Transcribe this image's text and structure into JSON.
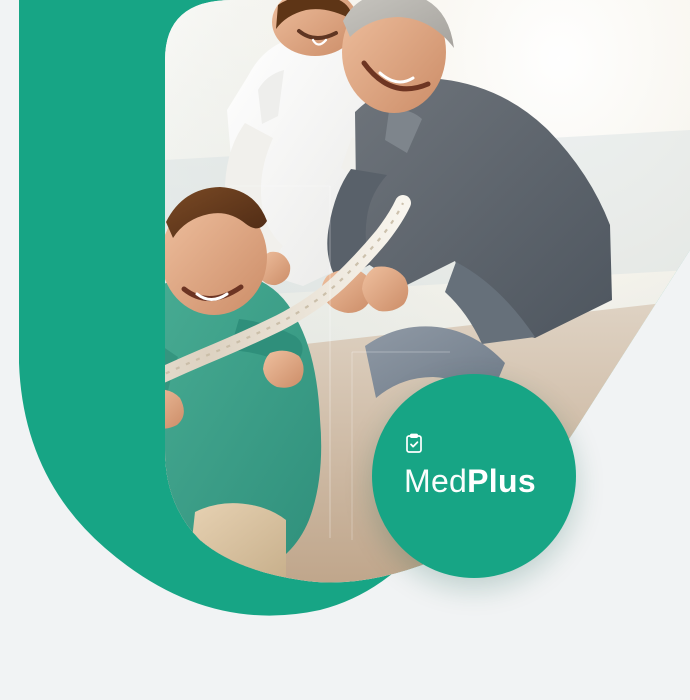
{
  "brand": {
    "name_light": "Med",
    "name_bold": "Plus",
    "icon": "clipboard-check-icon",
    "logo_text_color": "#ffffff",
    "logo_circle_color": "#17a585"
  },
  "colors": {
    "background": "#f1f3f4",
    "accent": "#17a585",
    "accent_dark": "#0e8d70"
  },
  "photo": {
    "subject": "family-tug-of-war-photo"
  }
}
